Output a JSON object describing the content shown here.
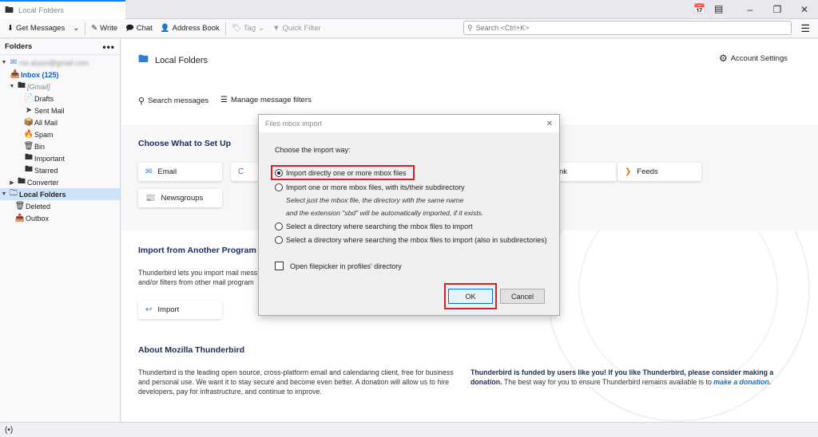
{
  "window": {
    "tab_label": "Local Folders",
    "controls": [
      "minimize",
      "restore",
      "close"
    ]
  },
  "toolbar": {
    "get_messages": "Get Messages",
    "write": "Write",
    "chat": "Chat",
    "address_book": "Address Book",
    "tag": "Tag",
    "quick_filter": "Quick Filter",
    "search_placeholder": "Search <Ctrl+K>"
  },
  "folder_pane": {
    "header": "Folders",
    "account_email": "ms.aryon@gmail.com",
    "inbox": "Inbox (125)",
    "gmail": "[Gmail]",
    "gmail_items": [
      "Drafts",
      "Sent Mail",
      "All Mail",
      "Spam",
      "Bin",
      "Important",
      "Starred"
    ],
    "converter": "Converter",
    "local_folders": "Local Folders",
    "local_items": [
      "Deleted",
      "Outbox"
    ]
  },
  "main": {
    "title": "Local Folders",
    "account_settings": "Account Settings",
    "search_messages": "Search messages",
    "manage_filters": "Manage message filters",
    "setup_heading": "Choose What to Set Up",
    "setup_cards": {
      "email": "Email",
      "calendar_partial": "C",
      "feeds_partial": "nk",
      "feeds": "Feeds",
      "newsgroups": "Newsgroups"
    },
    "import_heading": "Import from Another Program",
    "import_text_1": "Thunderbird lets you import mail mess",
    "import_text_2": "and/or filters from other mail program",
    "import_button": "Import",
    "about_heading": "About Mozilla Thunderbird",
    "about_text_1": "Thunderbird is the leading open source, cross-platform email and calendaring client, free for business",
    "about_text_2": "and personal use. We want it to stay secure and become even better. A donation will allow us to hire",
    "about_text_3": "developers, pay for infrastructure, and continue to improve.",
    "funded_bold": "Thunderbird is funded by users like you! If you like Thunderbird, please consider making a",
    "funded_bold_2": "donation.",
    "funded_text": " The best way for you to ensure Thunderbird remains available is to ",
    "funded_link": "make a donation."
  },
  "dialog": {
    "title": "Files mbox import",
    "prompt": "Choose the import way:",
    "options": [
      "Import directly one or more mbox files",
      "Import one or more mbox files, with its/their subdirectory",
      "Select a directory where searching the mbox files to import",
      "Select a directory where searching the mbox files to import (also in subdirectories)"
    ],
    "hint_1": "Select just the mbox file, the directory with the same name",
    "hint_2": "and the extension \"sbd\" will be automatically imported, if it exists.",
    "checkbox_label": "Open filepicker in profiles' directory",
    "ok": "OK",
    "cancel": "Cancel",
    "selected_index": 0
  },
  "colors": {
    "accent": "#0a84ff",
    "highlight_box": "#d3202a",
    "heading": "#1c2c58",
    "selected_folder": "#cfe3fb"
  }
}
